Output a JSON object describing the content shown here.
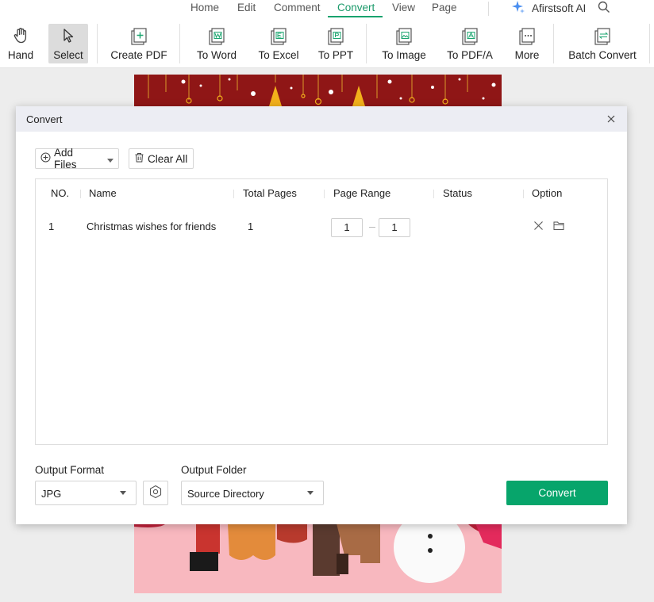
{
  "menu": {
    "tabs": [
      "Home",
      "Edit",
      "Comment",
      "Convert",
      "View",
      "Page"
    ],
    "active_tab": "Convert",
    "ai_label": "Afirstsoft AI"
  },
  "toolbar": {
    "hand": "Hand",
    "select": "Select",
    "create_pdf": "Create PDF",
    "to_word": "To Word",
    "to_excel": "To Excel",
    "to_ppt": "To PPT",
    "to_image": "To Image",
    "to_pdfa": "To PDF/A",
    "more": "More",
    "batch_convert": "Batch Convert"
  },
  "dialog": {
    "title": "Convert",
    "add_files": "Add Files",
    "clear_all": "Clear All",
    "columns": {
      "no": "NO.",
      "name": "Name",
      "total_pages": "Total Pages",
      "page_range": "Page Range",
      "status": "Status",
      "option": "Option"
    },
    "rows": [
      {
        "no": "1",
        "name": "Christmas wishes for friends",
        "total_pages": "1",
        "range_from": "1",
        "range_to": "1",
        "status": ""
      }
    ],
    "output_format_label": "Output Format",
    "output_format_value": "JPG",
    "output_folder_label": "Output Folder",
    "output_folder_value": "Source Directory",
    "convert_button": "Convert"
  },
  "colors": {
    "accent": "#07a56b",
    "doc_band": "#8f1616",
    "doc_pink": "#f7c2c6"
  }
}
